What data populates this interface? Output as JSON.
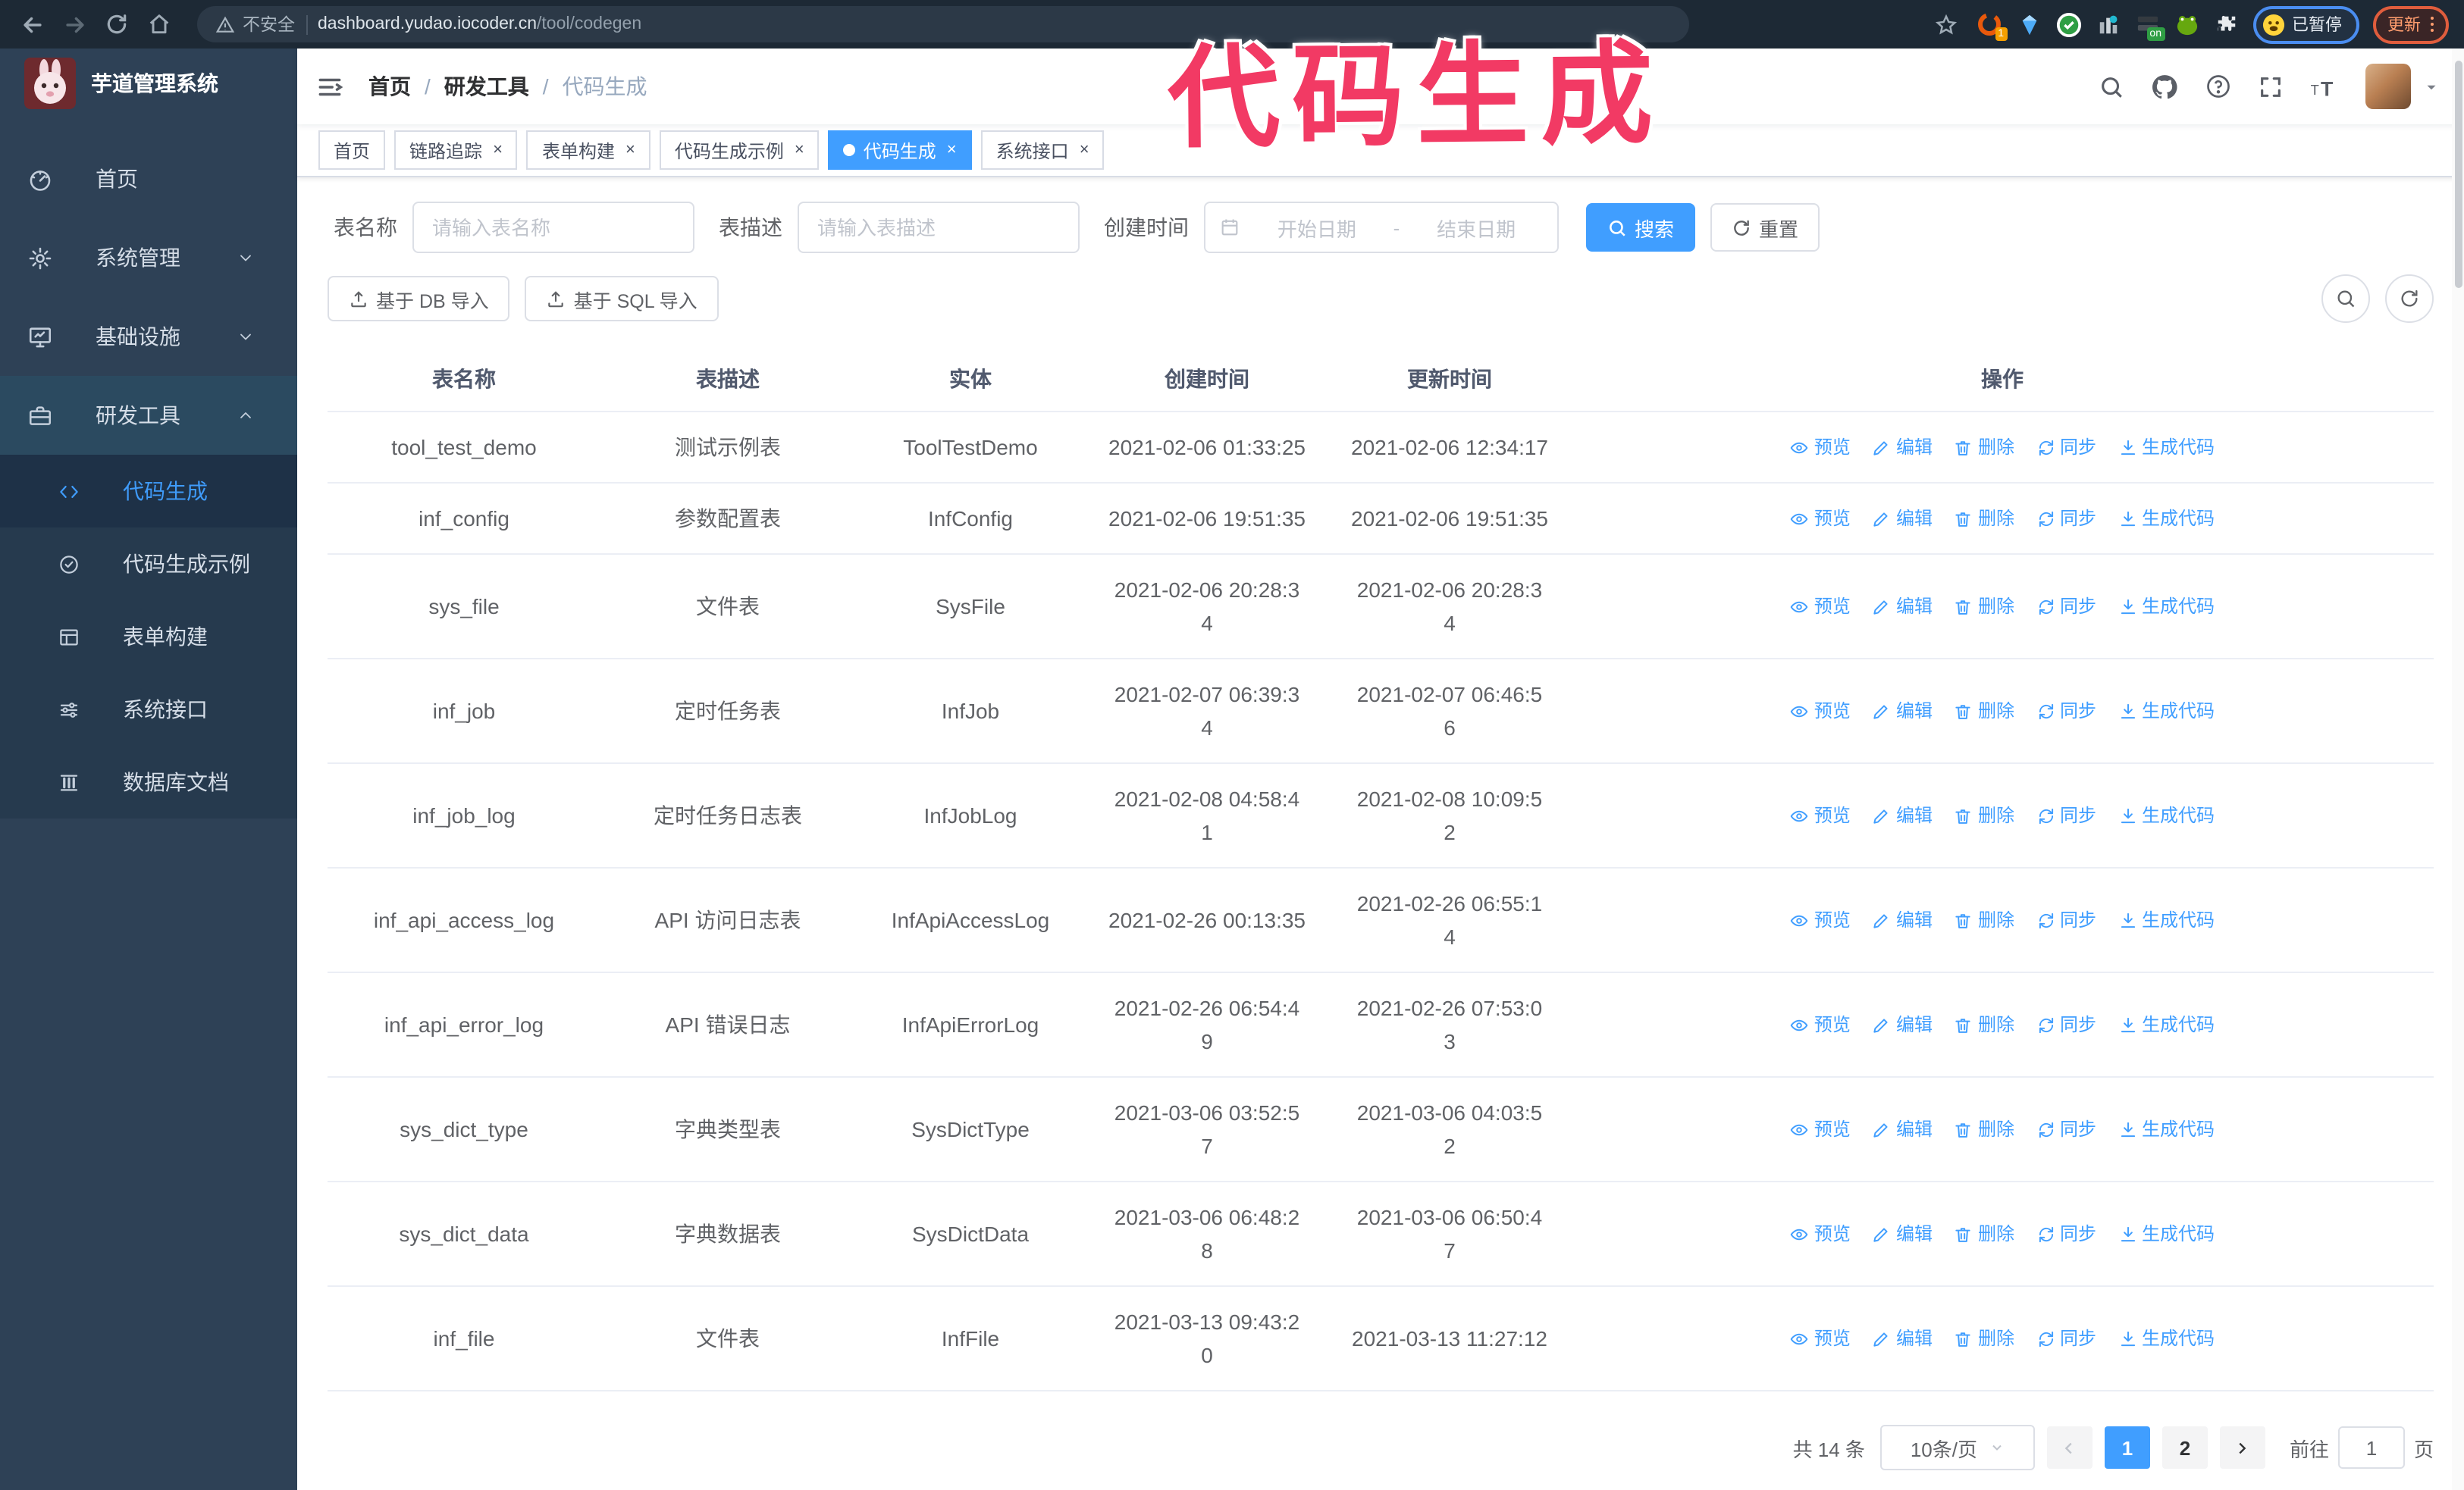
{
  "browser": {
    "security_text": "不安全",
    "url_host": "dashboard.yudao.iocoder.cn",
    "url_path": "/tool/codegen",
    "extension_badge": "1",
    "extension_on_badge": "on",
    "paused_label": "已暂停",
    "update_label": "更新"
  },
  "annotation": {
    "text": "代码生成",
    "color": "#f23a64"
  },
  "sidebar": {
    "logo_title": "芋道管理系统",
    "menu": [
      {
        "label": "首页",
        "icon": "dashboard-icon",
        "chevron": null,
        "open": false
      },
      {
        "label": "系统管理",
        "icon": "gear-icon",
        "chevron": "down",
        "open": false
      },
      {
        "label": "基础设施",
        "icon": "monitor-icon",
        "chevron": "down",
        "open": false
      },
      {
        "label": "研发工具",
        "icon": "toolbox-icon",
        "chevron": "up",
        "open": true
      }
    ],
    "submenu": [
      {
        "label": "代码生成",
        "icon": "code-icon",
        "active": true
      },
      {
        "label": "代码生成示例",
        "icon": "badge-check-icon",
        "active": false
      },
      {
        "label": "表单构建",
        "icon": "form-icon",
        "active": false
      },
      {
        "label": "系统接口",
        "icon": "sliders-icon",
        "active": false
      },
      {
        "label": "数据库文档",
        "icon": "columns-icon",
        "active": false
      }
    ]
  },
  "navbar": {
    "breadcrumb": [
      "首页",
      "研发工具",
      "代码生成"
    ]
  },
  "tabs": [
    {
      "label": "首页",
      "closable": false,
      "active": false
    },
    {
      "label": "链路追踪",
      "closable": true,
      "active": false
    },
    {
      "label": "表单构建",
      "closable": true,
      "active": false
    },
    {
      "label": "代码生成示例",
      "closable": true,
      "active": false
    },
    {
      "label": "代码生成",
      "closable": true,
      "active": true
    },
    {
      "label": "系统接口",
      "closable": true,
      "active": false
    }
  ],
  "filters": {
    "table_name_label": "表名称",
    "table_name_placeholder": "请输入表名称",
    "table_desc_label": "表描述",
    "table_desc_placeholder": "请输入表描述",
    "create_time_label": "创建时间",
    "date_start_placeholder": "开始日期",
    "date_separator": "-",
    "date_end_placeholder": "结束日期",
    "search_label": "搜索",
    "reset_label": "重置"
  },
  "toolbar": {
    "import_db_label": "基于 DB 导入",
    "import_sql_label": "基于 SQL 导入"
  },
  "table": {
    "columns": [
      "表名称",
      "表描述",
      "实体",
      "创建时间",
      "更新时间",
      "操作"
    ],
    "action_labels": [
      "预览",
      "编辑",
      "删除",
      "同步",
      "生成代码"
    ],
    "rows": [
      {
        "name": "tool_test_demo",
        "desc": "测试示例表",
        "entity": "ToolTestDemo",
        "created": "2021-02-06 01:33:25",
        "updated": "2021-02-06 12:34:17",
        "cw": false,
        "uw": false
      },
      {
        "name": "inf_config",
        "desc": "参数配置表",
        "entity": "InfConfig",
        "created": "2021-02-06 19:51:35",
        "updated": "2021-02-06 19:51:35",
        "cw": false,
        "uw": false
      },
      {
        "name": "sys_file",
        "desc": "文件表",
        "entity": "SysFile",
        "created": "2021-02-06 20:28:34",
        "updated": "2021-02-06 20:28:34",
        "cw": true,
        "uw": true
      },
      {
        "name": "inf_job",
        "desc": "定时任务表",
        "entity": "InfJob",
        "created": "2021-02-07 06:39:34",
        "updated": "2021-02-07 06:46:56",
        "cw": true,
        "uw": true
      },
      {
        "name": "inf_job_log",
        "desc": "定时任务日志表",
        "entity": "InfJobLog",
        "created": "2021-02-08 04:58:41",
        "updated": "2021-02-08 10:09:52",
        "cw": true,
        "uw": true
      },
      {
        "name": "inf_api_access_log",
        "desc": "API 访问日志表",
        "entity": "InfApiAccessLog",
        "created": "2021-02-26 00:13:35",
        "updated": "2021-02-26 06:55:14",
        "cw": false,
        "uw": true
      },
      {
        "name": "inf_api_error_log",
        "desc": "API 错误日志",
        "entity": "InfApiErrorLog",
        "created": "2021-02-26 06:54:49",
        "updated": "2021-02-26 07:53:03",
        "cw": true,
        "uw": true
      },
      {
        "name": "sys_dict_type",
        "desc": "字典类型表",
        "entity": "SysDictType",
        "created": "2021-03-06 03:52:57",
        "updated": "2021-03-06 04:03:52",
        "cw": true,
        "uw": true
      },
      {
        "name": "sys_dict_data",
        "desc": "字典数据表",
        "entity": "SysDictData",
        "created": "2021-03-06 06:48:28",
        "updated": "2021-03-06 06:50:47",
        "cw": true,
        "uw": true
      },
      {
        "name": "inf_file",
        "desc": "文件表",
        "entity": "InfFile",
        "created": "2021-03-13 09:43:20",
        "updated": "2021-03-13 11:27:12",
        "cw": true,
        "uw": false
      }
    ]
  },
  "pagination": {
    "total_text": "共 14 条",
    "page_size_text": "10条/页",
    "pages": [
      "1",
      "2"
    ],
    "active_page": "1",
    "goto_label": "前往",
    "goto_value": "1",
    "goto_suffix": "页"
  }
}
